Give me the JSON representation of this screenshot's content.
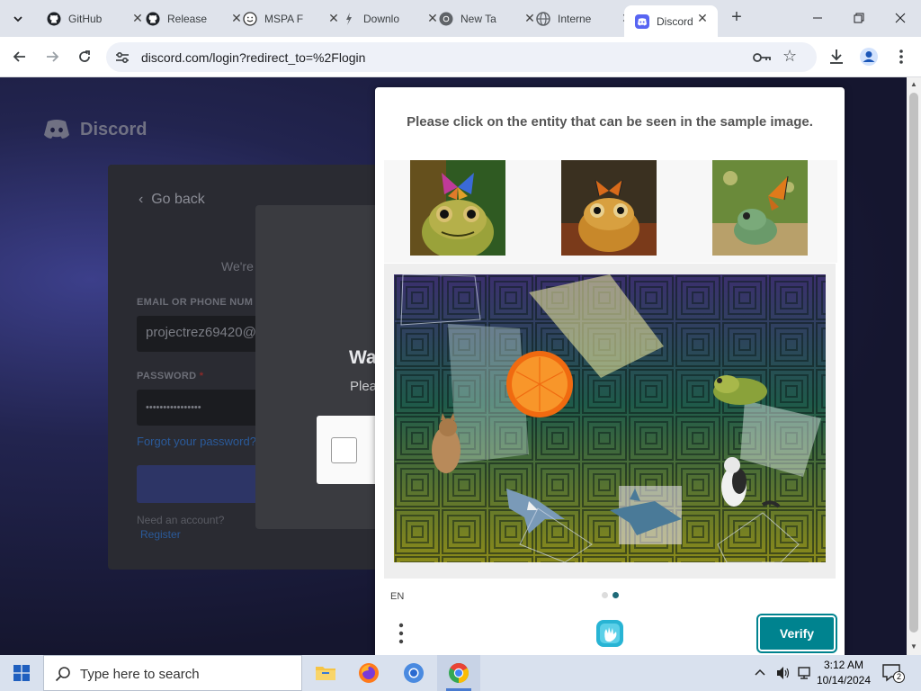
{
  "browser": {
    "tabs": [
      {
        "title": "GitHub",
        "icon": "github-icon"
      },
      {
        "title": "Release",
        "icon": "github-icon"
      },
      {
        "title": "MSPA F",
        "icon": "smiley-icon"
      },
      {
        "title": "Downlo",
        "icon": "download-arrow-icon"
      },
      {
        "title": "New Ta",
        "icon": "chrome-icon"
      },
      {
        "title": "Interne",
        "icon": "globe-icon"
      },
      {
        "title": "Discord",
        "icon": "discord-icon",
        "active": true
      }
    ],
    "url": "discord.com/login?redirect_to=%2Flogin"
  },
  "discord": {
    "brand": "Discord",
    "go_back": "Go back",
    "welcome_fragment": "We're",
    "email_label": "EMAIL OR PHONE NUM",
    "email_value": "projectrez69420@",
    "password_label": "PASSWORD",
    "password_required": "*",
    "password_value": "••••••••••••••••",
    "forgot": "Forgot your password?",
    "need_account": "Need an account?",
    "register": "Register",
    "wait_title": "Wa",
    "wait_sub": "Plea"
  },
  "captcha": {
    "prompt": "Please click on the entity that can be seen in the sample image.",
    "samples": [
      "frog-with-butterfly",
      "frog-with-butterfly",
      "frog-with-butterfly"
    ],
    "language": "EN",
    "verify_label": "Verify",
    "page_total": 2,
    "page_current": 2
  },
  "taskbar": {
    "search_placeholder": "Type here to search",
    "time": "3:12 AM",
    "date": "10/14/2024",
    "notification_count": "2"
  },
  "colors": {
    "verify": "#00838f",
    "discord_bg": "#1a1b3a"
  }
}
